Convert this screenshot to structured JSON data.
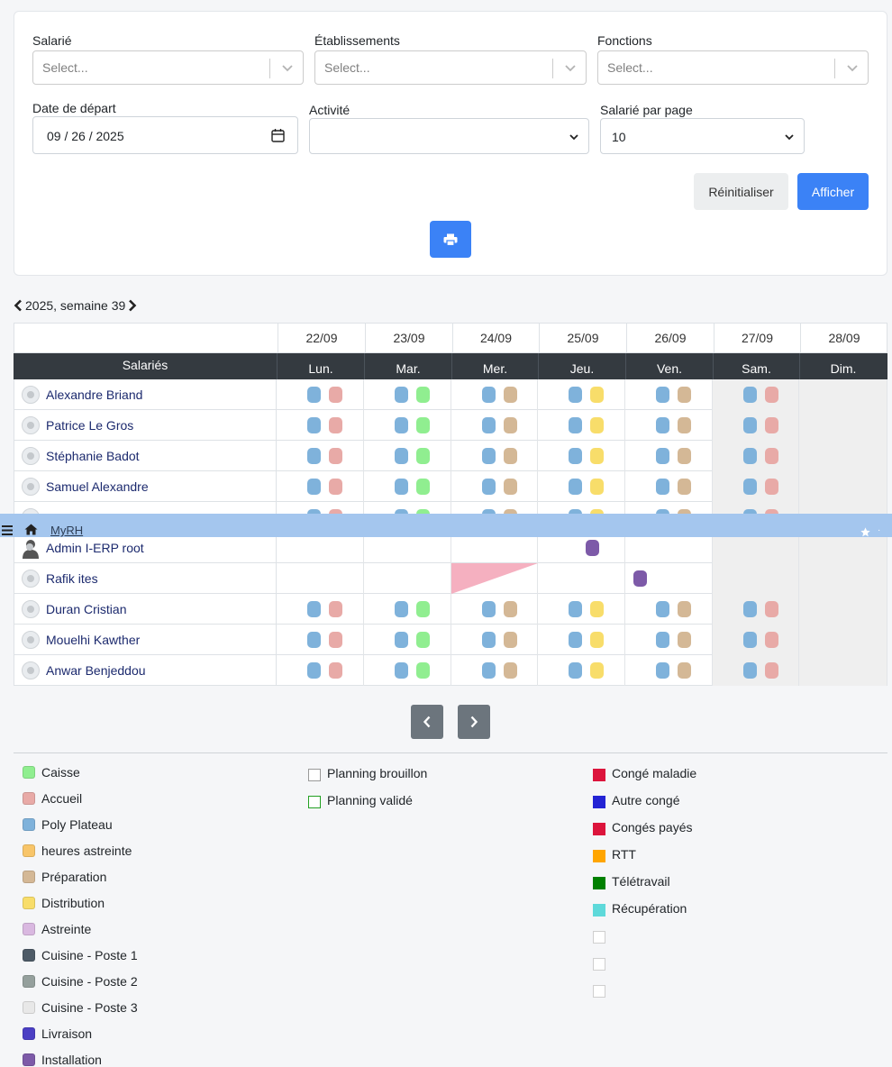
{
  "filters": {
    "salarie": {
      "label": "Salarié",
      "placeholder": "Select..."
    },
    "etablissements": {
      "label": "Établissements",
      "placeholder": "Select..."
    },
    "fonctions": {
      "label": "Fonctions",
      "placeholder": "Select..."
    },
    "date_depart": {
      "label": "Date de départ",
      "value": "09 / 26 / 2025"
    },
    "activite": {
      "label": "Activité",
      "value": ""
    },
    "salarie_par_page": {
      "label": "Salarié par page",
      "value": "10"
    },
    "reset_label": "Réinitialiser",
    "show_label": "Afficher"
  },
  "week": {
    "label": "2025, semaine 39"
  },
  "grid": {
    "employees_header": "Salariés",
    "dates": [
      "22/09",
      "23/09",
      "24/09",
      "25/09",
      "26/09",
      "27/09",
      "28/09"
    ],
    "days": [
      "Lun.",
      "Mar.",
      "Mer.",
      "Jeu.",
      "Ven.",
      "Sam.",
      "Dim."
    ],
    "rows": [
      {
        "name": "Alexandre Briand"
      },
      {
        "name": "Patrice Le Gros"
      },
      {
        "name": "Stéphanie Badot"
      },
      {
        "name": "Samuel Alexandre"
      },
      {
        "name": ""
      },
      {
        "name": "Admin I-ERP root"
      },
      {
        "name": "Rafik ites"
      },
      {
        "name": "Duran Cristian"
      },
      {
        "name": "Mouelhi Kawther"
      },
      {
        "name": "Anwar Benjeddou"
      }
    ]
  },
  "topbar": {
    "link": "MyRH"
  },
  "colors": {
    "caisse": "#90ee90",
    "accueil": "#e8aaa7",
    "poly_plateau": "#7fb2db",
    "heures_astreinte": "#f8c569",
    "preparation": "#d4b896",
    "distribution": "#f8dd6a",
    "astreinte": "#d9b8e0",
    "cuisine_1": "#4d5a66",
    "cuisine_2": "#95a09d",
    "cuisine_3": "#e8e8e8",
    "livraison": "#4b3fc4",
    "installation": "#7d5aa8",
    "conge_maladie": "#dc143c",
    "autre_conge": "#2323d4",
    "conges_payes": "#dc143c",
    "rtt": "#ffa500",
    "teletravail": "#008000",
    "recuperation": "#5ed9da",
    "brouillon_border": "#999999",
    "valide_border": "#22a022",
    "pink_tri": "#f5b0c0"
  },
  "legend": {
    "col1": [
      "Caisse",
      "Accueil",
      "Poly Plateau",
      "heures astreinte",
      "Préparation",
      "Distribution",
      "Astreinte",
      "Cuisine - Poste 1",
      "Cuisine - Poste 2",
      "Cuisine - Poste 3",
      "Livraison",
      "Installation"
    ],
    "col2": [
      "Planning brouillon",
      "Planning validé"
    ],
    "col3": [
      "Congé maladie",
      "Autre congé",
      "Congés payés",
      "RTT",
      "Télétravail",
      "Récupération"
    ]
  }
}
